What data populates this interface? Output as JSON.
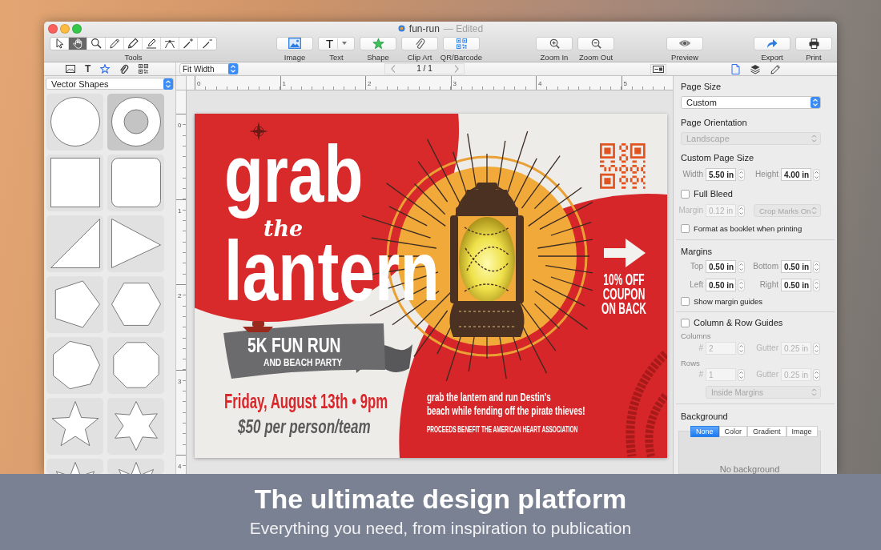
{
  "window": {
    "title": "fun-run",
    "status": "— Edited"
  },
  "toolbar": {
    "tools_label": "Tools",
    "tools": [
      {
        "selected": false
      },
      {
        "selected": true
      },
      {
        "selected": false
      },
      {
        "selected": false
      },
      {
        "selected": false
      },
      {
        "selected": false
      },
      {
        "selected": false
      },
      {
        "selected": false
      },
      {
        "selected": false
      }
    ],
    "groups": [
      [
        {
          "label": "Image",
          "menu": false
        },
        {
          "label": "Text",
          "glyph": "T",
          "menu": true
        },
        {
          "label": "Shape",
          "menu": false
        },
        {
          "label": "Clip Art",
          "menu": false
        },
        {
          "label": "QR/Barcode",
          "menu": false
        }
      ],
      [
        {
          "label": "Zoom In",
          "menu": false
        },
        {
          "label": "Zoom Out",
          "menu": false
        }
      ],
      [
        {
          "label": "Preview",
          "menu": false
        }
      ],
      [
        {
          "label": "Export",
          "menu": false
        },
        {
          "label": "Print",
          "menu": false
        }
      ]
    ]
  },
  "format_bar": {
    "insert_tabs": [
      {
        "selected": false
      },
      {
        "glyph": "T",
        "selected": false
      },
      {
        "selected": true
      },
      {
        "selected": false
      },
      {
        "selected": false
      }
    ],
    "zoom": "Fit Width",
    "page": "1 / 1",
    "inspector_tabs": [
      {
        "selected": true
      },
      {
        "selected": false
      },
      {
        "selected": false
      }
    ]
  },
  "library": {
    "category": "Vector Shapes",
    "shapes": [
      {
        "selected": false
      },
      {
        "selected": true
      },
      {
        "selected": false
      },
      {
        "selected": false
      },
      {
        "selected": false
      },
      {
        "selected": false
      },
      {
        "selected": false
      },
      {
        "selected": false
      },
      {
        "selected": false
      },
      {
        "selected": false
      },
      {
        "selected": false
      },
      {
        "selected": false
      },
      {
        "selected": false
      },
      {
        "selected": false
      }
    ]
  },
  "rulers": {
    "horizontal": [
      "0",
      "1",
      "2",
      "3",
      "4",
      "5"
    ],
    "vertical": [
      "0",
      "1",
      "2",
      "3",
      "4"
    ]
  },
  "document": {
    "headline_top": "grab",
    "headline_script": "the",
    "headline_bottom": "lantern",
    "ribbon_title": "5K FUN RUN",
    "ribbon_subtitle": "AND BEACH PARTY",
    "date": "Friday, August 13th • 9pm",
    "price": "$50 per person/team",
    "description": "grab the lantern and run Destin's\nbeach while fending off the pirate thieves!",
    "proceeds": "PROCEEDS BENEFIT THE AMERICAN HEART ASSOCIATION",
    "coupon": "10% OFF\nCOUPON\nON BACK"
  },
  "inspector": {
    "page_size": {
      "label": "Page Size",
      "value": "Custom"
    },
    "orientation": {
      "label": "Page Orientation",
      "value": "Landscape",
      "disabled": true
    },
    "custom_size": {
      "label": "Custom Page Size",
      "fields": [
        {
          "label": "Width",
          "value": "5.50 in"
        },
        {
          "label": "Height",
          "value": "4.00 in"
        }
      ]
    },
    "full_bleed": {
      "label": "Full Bleed",
      "checked": false,
      "disabled": true,
      "margin": {
        "label": "Margin",
        "value": "0.12 in"
      },
      "crop_marks": "Crop Marks On"
    },
    "booklet": {
      "label": "Format as booklet when printing",
      "checked": false
    },
    "margins": {
      "label": "Margins",
      "fields": [
        {
          "label": "Top",
          "value": "0.50 in"
        },
        {
          "label": "Bottom",
          "value": "0.50 in"
        },
        {
          "label": "Left",
          "value": "0.50 in"
        },
        {
          "label": "Right",
          "value": "0.50 in"
        }
      ],
      "show_guides": {
        "label": "Show margin guides",
        "checked": false
      }
    },
    "guides": {
      "label": "Column & Row Guides",
      "checked": false,
      "disabled": true,
      "sections": [
        {
          "label": "Columns",
          "count": {
            "label": "#",
            "value": "2"
          },
          "gutter": {
            "label": "Gutter",
            "value": "0.25 in"
          }
        },
        {
          "label": "Rows",
          "count": {
            "label": "#",
            "value": "1"
          },
          "gutter": {
            "label": "Gutter",
            "value": "0.25 in"
          }
        }
      ],
      "placement": "Inside Margins"
    },
    "background": {
      "label": "Background",
      "tabs": [
        {
          "label": "None",
          "selected": true
        },
        {
          "label": "Color",
          "selected": false
        },
        {
          "label": "Gradient",
          "selected": false
        },
        {
          "label": "Image",
          "selected": false
        }
      ],
      "message": "No background"
    }
  },
  "banner": {
    "title": "The ultimate design platform",
    "subtitle": "Everything you need, from inspiration to publication"
  }
}
